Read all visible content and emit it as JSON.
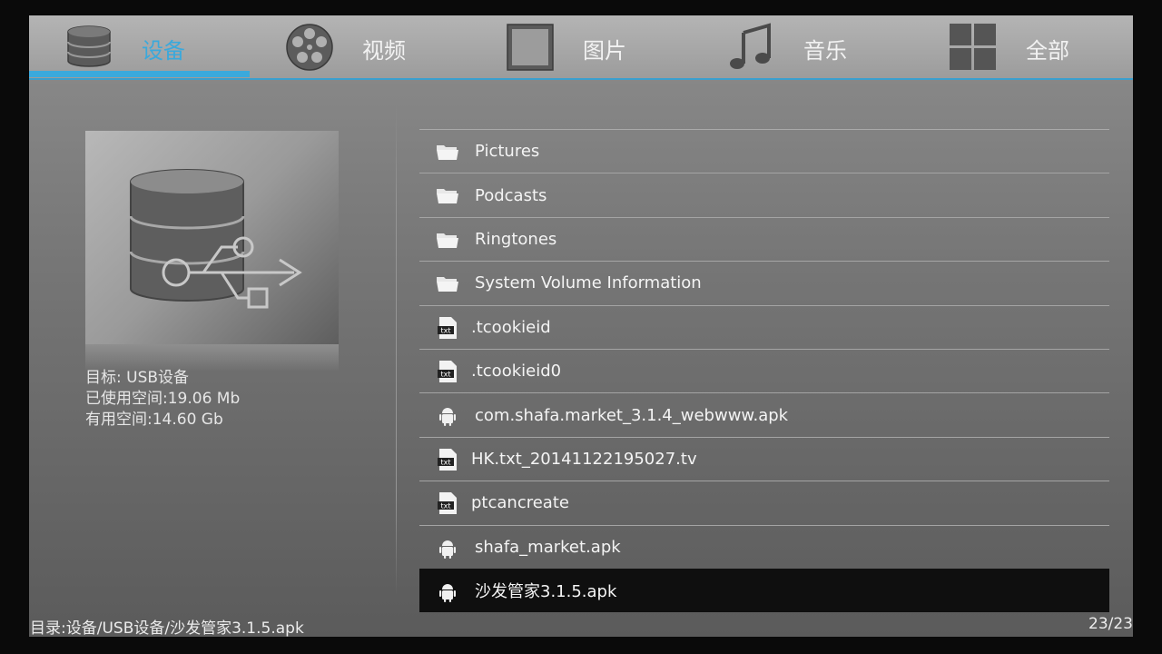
{
  "tabs": [
    {
      "label": "设备",
      "icon": "database-icon",
      "active": true
    },
    {
      "label": "视频",
      "icon": "film-reel-icon",
      "active": false
    },
    {
      "label": "图片",
      "icon": "picture-frame-icon",
      "active": false
    },
    {
      "label": "音乐",
      "icon": "music-note-icon",
      "active": false
    },
    {
      "label": "全部",
      "icon": "grid-icon",
      "active": false
    }
  ],
  "device": {
    "icon": "usb-database-icon",
    "target": "目标: USB设备",
    "used": "已使用空间:19.06 Mb",
    "free": "有用空间:14.60 Gb"
  },
  "files": [
    {
      "name": "Pictures",
      "type": "folder"
    },
    {
      "name": "Podcasts",
      "type": "folder"
    },
    {
      "name": "Ringtones",
      "type": "folder"
    },
    {
      "name": "System Volume Information",
      "type": "folder"
    },
    {
      "name": ".tcookieid",
      "type": "txt"
    },
    {
      "name": ".tcookieid0",
      "type": "txt"
    },
    {
      "name": "com.shafa.market_3.1.4_webwww.apk",
      "type": "apk"
    },
    {
      "name": "HK.txt_20141122195027.tv",
      "type": "txt"
    },
    {
      "name": "ptcancreate",
      "type": "txt"
    },
    {
      "name": "shafa_market.apk",
      "type": "apk"
    },
    {
      "name": "沙发管家3.1.5.apk",
      "type": "apk",
      "selected": true
    }
  ],
  "status": {
    "path": "目录:设备/USB设备/沙发管家3.1.5.apk",
    "count": "23/23"
  },
  "colors": {
    "accent": "#3aa9dc",
    "selected_row": "#0f0f0f"
  }
}
